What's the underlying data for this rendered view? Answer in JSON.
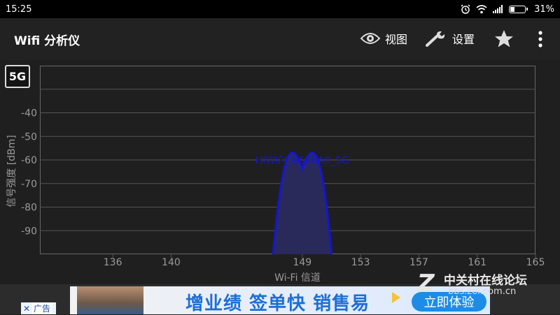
{
  "status_bar": {
    "time": "15:25",
    "battery_text": "31%",
    "battery_level": 0.31,
    "icons": [
      "alarm-icon",
      "wifi-icon",
      "signal-icon",
      "battery-icon"
    ]
  },
  "app_bar": {
    "title": "Wifi 分析仪",
    "view_label": "视图",
    "settings_label": "设置",
    "icons": [
      "eye-icon",
      "wrench-icon",
      "star-icon",
      "overflow-menu-icon"
    ]
  },
  "band_label": "5G",
  "colors": {
    "background": "#1f1f1f",
    "grid": "#555555",
    "axis_text": "#9a9a9a",
    "network_line": "#1515d6",
    "network_fill": "#2a2a5a"
  },
  "chart_data": {
    "type": "area",
    "xlabel": "Wi-Fi 信道",
    "ylabel": "信号强度 [dBm]",
    "xlim": [
      131,
      165
    ],
    "ylim": [
      -100,
      -20
    ],
    "x_ticks": [
      136,
      140,
      149,
      153,
      157,
      161,
      165
    ],
    "y_ticks": [
      -40,
      -50,
      -60,
      -70,
      -80,
      -90
    ],
    "grid": true,
    "series": [
      {
        "name": "HIWIFI_B69BA0_5G",
        "channel": 149,
        "width_channels": [
          147,
          151
        ],
        "peak_dbm": -64,
        "color": "#1515d6"
      }
    ]
  },
  "ad": {
    "close_symbol": "✕",
    "tag": "广告",
    "headline": "增业绩 签单快 销售易",
    "cta": "立即体验"
  },
  "watermark": {
    "logo_letter": "Z",
    "name": "中关村在线论坛",
    "url": "bbs.zol.com.cn"
  }
}
